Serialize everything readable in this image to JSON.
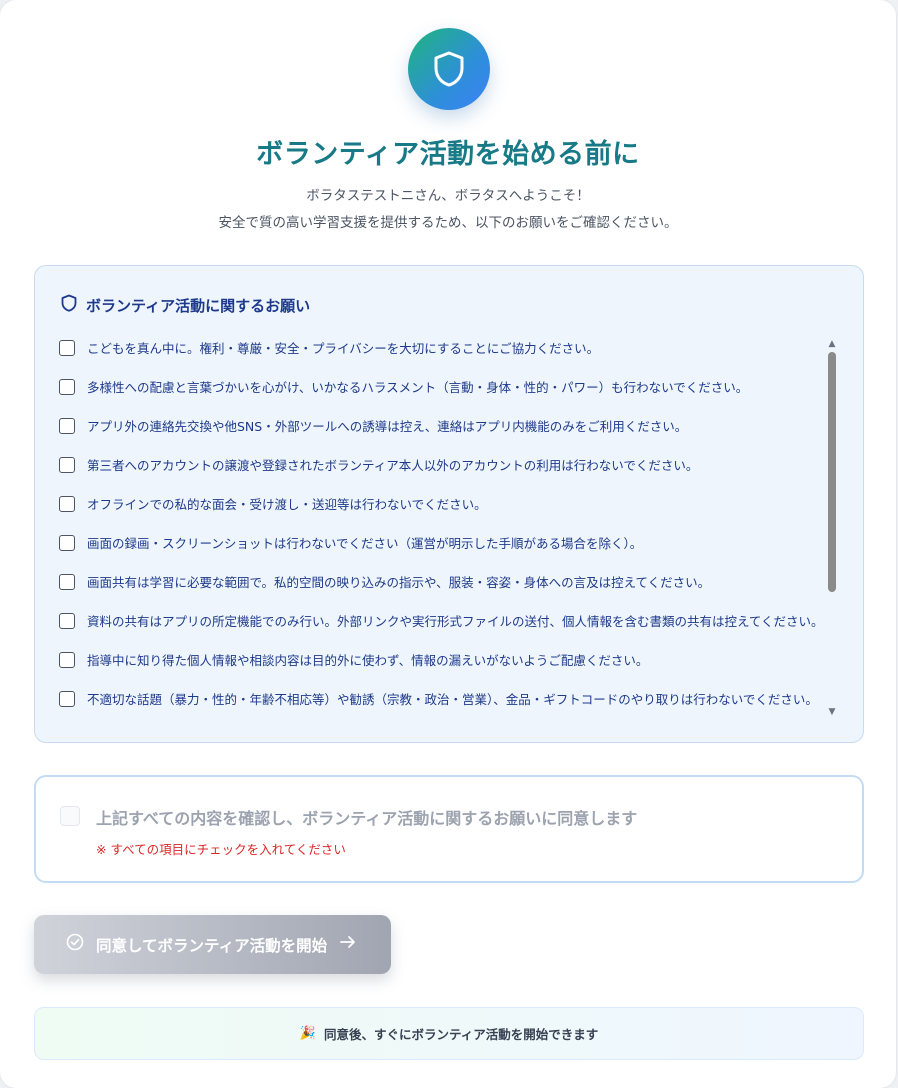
{
  "header": {
    "title": "ボランティア活動を始める前に",
    "greeting": "ボラタステストニさん、ボラタスへようこそ！",
    "subtitle": "安全で質の高い学習支援を提供するため、以下のお願いをご確認ください。"
  },
  "rules": {
    "heading": "ボランティア活動に関するお願い",
    "items": [
      {
        "label": "こどもを真ん中に。権利・尊厳・安全・プライバシーを大切にすることにご協力ください。",
        "checked": false
      },
      {
        "label": "多様性への配慮と言葉づかいを心がけ、いかなるハラスメント（言動・身体・性的・パワー）も行わないでください。",
        "checked": false
      },
      {
        "label": "アプリ外の連絡先交換や他SNS・外部ツールへの誘導は控え、連絡はアプリ内機能のみをご利用ください。",
        "checked": false
      },
      {
        "label": "第三者へのアカウントの譲渡や登録されたボランティア本人以外のアカウントの利用は行わないでください。",
        "checked": false
      },
      {
        "label": "オフラインでの私的な面会・受け渡し・送迎等は行わないでください。",
        "checked": false
      },
      {
        "label": "画面の録画・スクリーンショットは行わないでください（運営が明示した手順がある場合を除く）。",
        "checked": false
      },
      {
        "label": "画面共有は学習に必要な範囲で。私的空間の映り込みの指示や、服装・容姿・身体への言及は控えてください。",
        "checked": false
      },
      {
        "label": "資料の共有はアプリの所定機能でのみ行い。外部リンクや実行形式ファイルの送付、個人情報を含む書類の共有は控えてください。",
        "checked": false
      },
      {
        "label": "指導中に知り得た個人情報や相談内容は目的外に使わず、情報の漏えいがないようご配慮ください。",
        "checked": false
      },
      {
        "label": "不適切な話題（暴力・性的・年齢不相応等）や勧誘（宗教・政治・営業）、金品・ギフトコードのやり取りは行わないでください。",
        "checked": false
      }
    ]
  },
  "agreement": {
    "label": "上記すべての内容を確認し、ボランティア活動に関するお願いに同意します",
    "warning": "※ すべての項目にチェックを入れてください",
    "checked": false
  },
  "start_button": {
    "label": "同意してボランティア活動を開始",
    "disabled": true
  },
  "note": {
    "icon": "party-popper-icon",
    "text": "同意後、すぐにボランティア活動を開始できます"
  },
  "colors": {
    "title": "#177a86",
    "rules_bg": "#eef5fd",
    "rules_text": "#1e3a8a",
    "warning": "#dc2626"
  }
}
